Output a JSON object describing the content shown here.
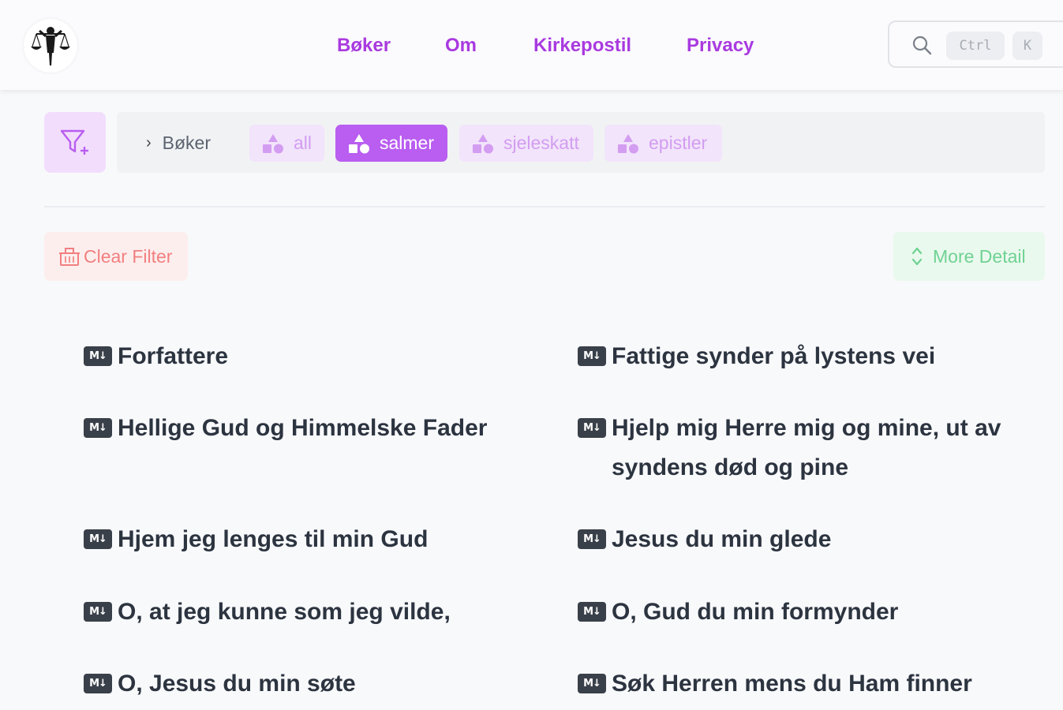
{
  "header": {
    "nav": [
      "Bøker",
      "Om",
      "Kirkepostil",
      "Privacy"
    ],
    "search": {
      "kbd_ctrl": "Ctrl",
      "kbd_k": "K"
    }
  },
  "filter": {
    "breadcrumb": "Bøker",
    "tags": [
      "all",
      "salmer",
      "sjeleskatt",
      "epistler"
    ],
    "active_tag": "salmer"
  },
  "actions": {
    "clear_filter": "Clear Filter",
    "more_detail": "More Detail"
  },
  "list": {
    "md_badge": "M↓",
    "items": [
      "Forfattere",
      "Fattige synder på lystens vei",
      "Hellige Gud og Himmelske Fader",
      "Hjelp mig Herre mig og mine, ut av syndens død og pine",
      "Hjem jeg lenges til min Gud",
      "Jesus du min glede",
      "O, at jeg kunne som jeg vilde,",
      "O, Gud du min formynder",
      "O, Jesus du min søte",
      "Søk Herren mens du Ham finner"
    ]
  },
  "colors": {
    "accent": "#a93ae0",
    "tag_active": "#b95ef0",
    "tag_inactive": "#f2e4fb",
    "clear": "#f27f7f",
    "detail": "#6fd293"
  }
}
